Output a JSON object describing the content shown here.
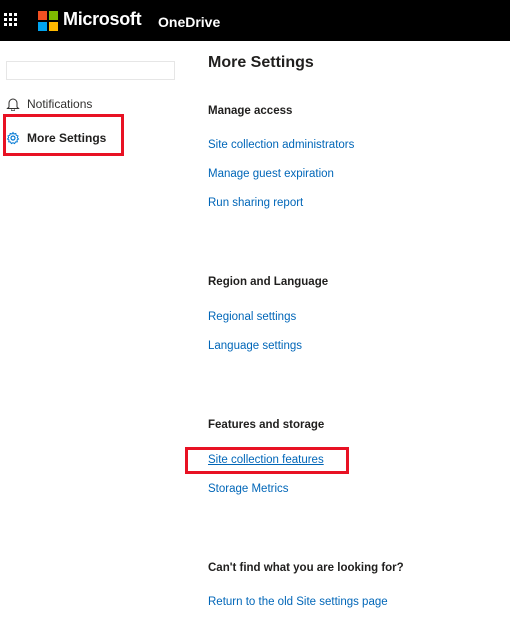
{
  "header": {
    "brand": "Microsoft",
    "app_name": "OneDrive",
    "waffle_icon": "waffle-icon",
    "logo_icon": "microsoft-logo-icon",
    "colors": {
      "bar": "#000000",
      "logo": [
        "#f25022",
        "#7fba00",
        "#00a4ef",
        "#ffb900"
      ]
    }
  },
  "sidebar": {
    "items": [
      {
        "label": "Notifications",
        "icon": "bell-icon",
        "selected": false
      },
      {
        "label": "More Settings",
        "icon": "gear-icon",
        "selected": true
      }
    ]
  },
  "main": {
    "title": "More Settings",
    "sections": [
      {
        "heading": "Manage access",
        "links": [
          "Site collection administrators",
          "Manage guest expiration",
          "Run sharing report"
        ]
      },
      {
        "heading": "Region and Language",
        "links": [
          "Regional settings",
          "Language settings"
        ]
      },
      {
        "heading": "Features and storage",
        "links": [
          "Site collection features",
          "Storage Metrics"
        ]
      },
      {
        "heading": "Can't find what you are looking for?",
        "links": [
          "Return to the old Site settings page"
        ]
      }
    ]
  },
  "annotations": {
    "highlight_color": "#e81123"
  },
  "link_color": "#0066b8"
}
